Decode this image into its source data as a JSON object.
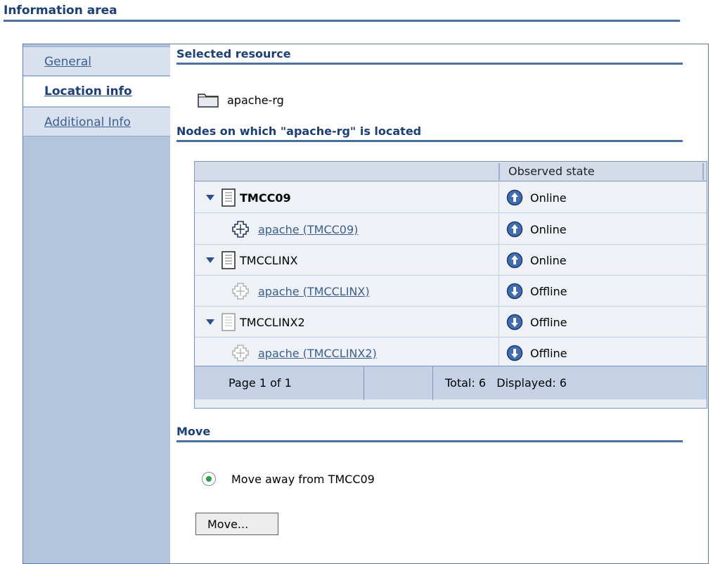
{
  "info_area": {
    "title": "Information area"
  },
  "tabs": [
    {
      "label": "General"
    },
    {
      "label": "Location info"
    },
    {
      "label": "Additional Info"
    }
  ],
  "selected_resource": {
    "heading": "Selected resource",
    "name": "apache-rg"
  },
  "nodes": {
    "heading": "Nodes on which \"apache-rg\" is located",
    "column_state": "Observed state",
    "rows": [
      {
        "name": "TMCC09",
        "state": "Online",
        "type": "node"
      },
      {
        "name": "apache (TMCC09)",
        "state": "Online",
        "type": "resource"
      },
      {
        "name": "TMCCLINX",
        "state": "Online",
        "type": "node"
      },
      {
        "name": "apache (TMCCLINX)",
        "state": "Offline",
        "type": "resource"
      },
      {
        "name": "TMCCLINX2",
        "state": "Offline",
        "type": "node"
      },
      {
        "name": "apache (TMCCLINX2)",
        "state": "Offline",
        "type": "resource"
      }
    ],
    "footer": {
      "page": "Page 1 of 1",
      "totals": "Total: 6   Displayed: 6"
    }
  },
  "move": {
    "heading": "Move",
    "option_label": "Move away from TMCC09",
    "button_label": "Move..."
  },
  "colors": {
    "heading": "#1b3f7a",
    "link": "#3a5f94",
    "sidebar": "#b3c4dd",
    "online": "#2c4f8c",
    "radio_selected": "#25a043"
  }
}
